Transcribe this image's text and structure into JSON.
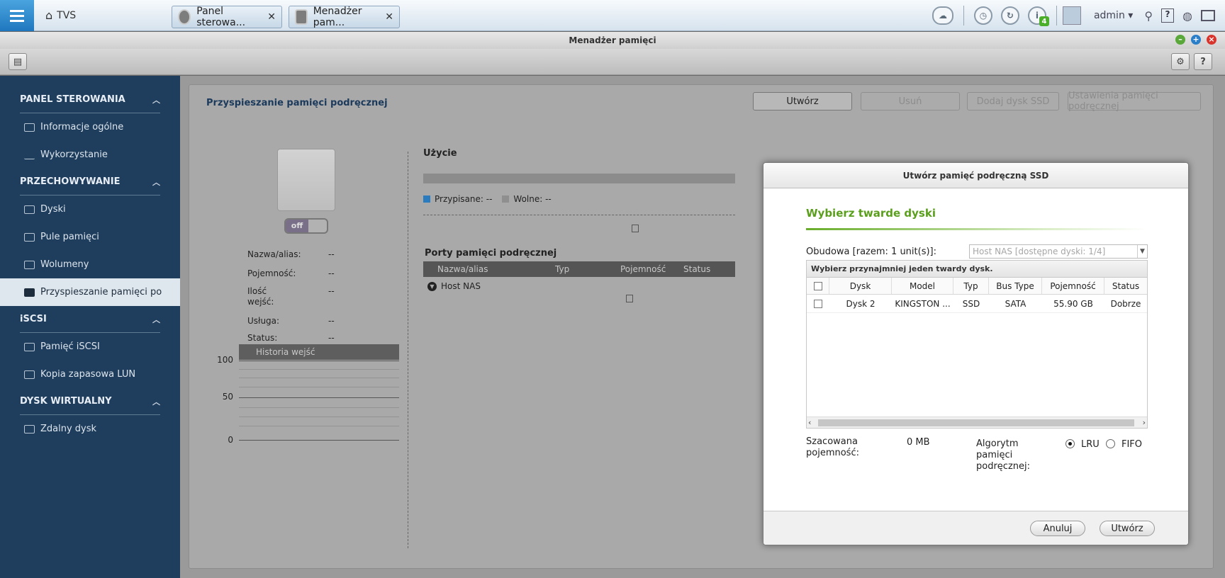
{
  "topbar": {
    "home_label": "TVS",
    "tabs": [
      {
        "label": "Panel sterowa..."
      },
      {
        "label": "Menadżer pam..."
      }
    ],
    "info_badge": "4",
    "user": "admin"
  },
  "window": {
    "title": "Menadżer pamięci"
  },
  "sidebar": {
    "sections": [
      {
        "title": "PANEL STEROWANIA",
        "items": [
          {
            "label": "Informacje ogólne"
          },
          {
            "label": "Wykorzystanie"
          }
        ]
      },
      {
        "title": "PRZECHOWYWANIE",
        "items": [
          {
            "label": "Dyski"
          },
          {
            "label": "Pule pamięci"
          },
          {
            "label": "Wolumeny"
          },
          {
            "label": "Przyspieszanie pamięci po"
          }
        ]
      },
      {
        "title": "iSCSI",
        "items": [
          {
            "label": "Pamięć iSCSI"
          },
          {
            "label": "Kopia zapasowa LUN"
          }
        ]
      },
      {
        "title": "DYSK WIRTUALNY",
        "items": [
          {
            "label": "Zdalny dysk"
          }
        ]
      }
    ]
  },
  "main": {
    "title": "Przyspieszanie pamięci podręcznej",
    "buttons": {
      "create": "Utwórz",
      "remove": "Usuń",
      "add_ssd": "Dodaj dysk SSD",
      "settings": "Ustawienia pamięci podręcznej"
    },
    "toggle": "off",
    "props": [
      {
        "label": "Nazwa/alias:",
        "value": "--"
      },
      {
        "label": "Pojemność:",
        "value": "--"
      },
      {
        "label": "Ilość wejść:",
        "value": "--"
      },
      {
        "label": "Usługa:",
        "value": "--"
      },
      {
        "label": "Status:",
        "value": "--"
      }
    ],
    "history_label": "Historia wejść",
    "history_ticks": [
      "100",
      "50",
      "0"
    ],
    "usage_title": "Użycie",
    "legend_assigned": "Przypisane: --",
    "legend_free": "Wolne: --",
    "ports_title": "Porty pamięci podręcznej",
    "ports_columns": [
      "Nazwa/alias",
      "Typ",
      "Pojemność",
      "Status"
    ],
    "ports_row": "Host NAS"
  },
  "dialog": {
    "title": "Utwórz pamięć podręczną SSD",
    "heading": "Wybierz twarde dyski",
    "enclosure_label": "Obudowa [razem: 1 unit(s)]:",
    "enclosure_value": "Host NAS [dostępne dyski: 1/4]",
    "grid_note": "Wybierz przynajmniej jeden twardy dysk.",
    "columns": [
      "Dysk",
      "Model",
      "Typ",
      "Bus Type",
      "Pojemność",
      "Status"
    ],
    "rows": [
      {
        "disk": "Dysk 2",
        "model": "KINGSTON ...",
        "type": "SSD",
        "bus": "SATA",
        "capacity": "55.90 GB",
        "status": "Dobrze"
      }
    ],
    "est_label": "Szacowana pojemność:",
    "est_value": "0 MB",
    "algo_label": "Algorytm pamięci podręcznej:",
    "algo_lru": "LRU",
    "algo_fifo": "FIFO",
    "cancel": "Anuluj",
    "create": "Utwórz"
  }
}
